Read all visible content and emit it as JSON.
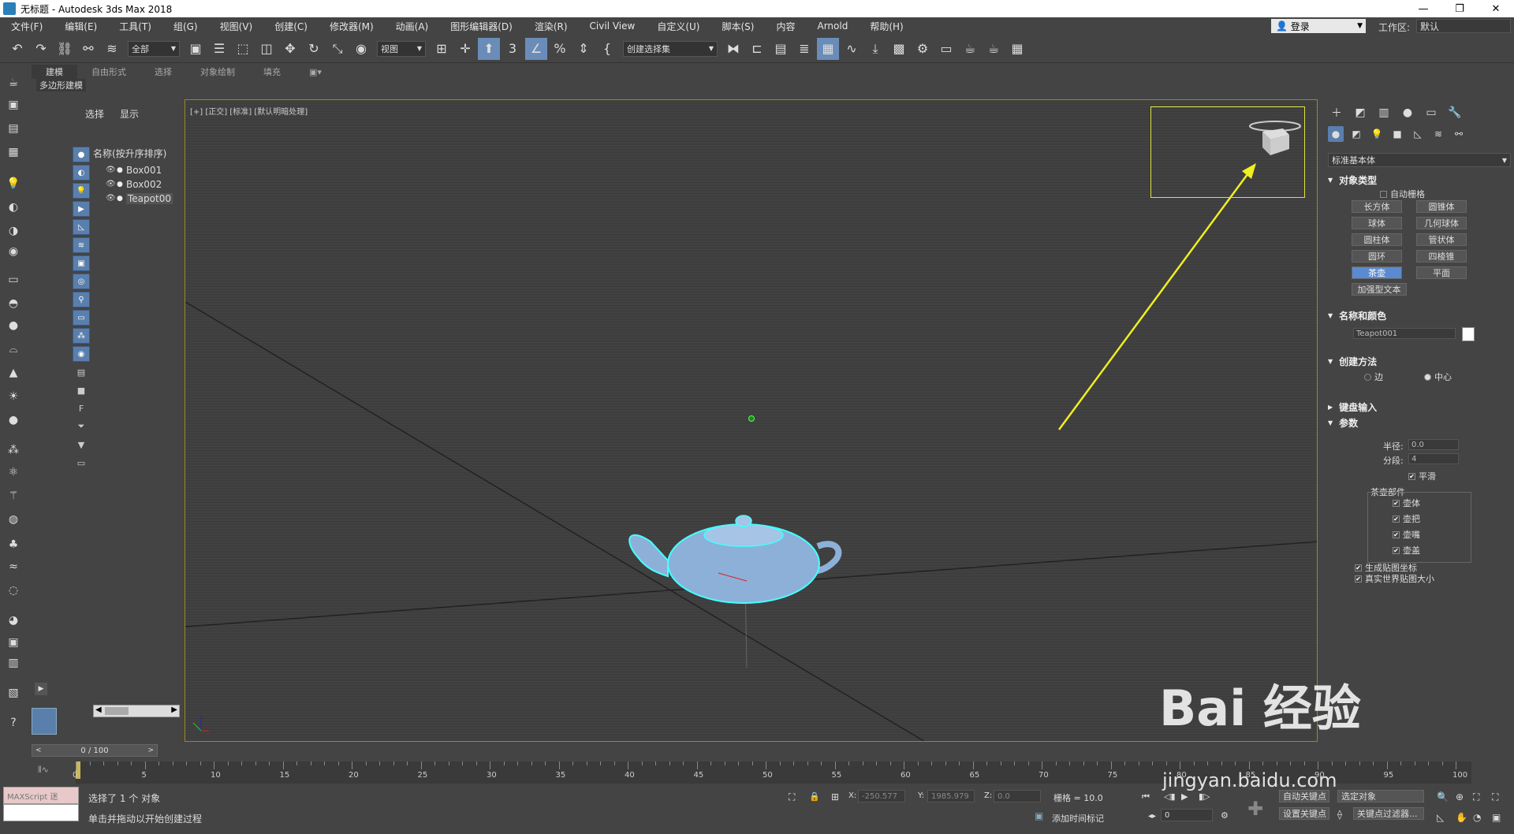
{
  "window": {
    "title": "无标题 - Autodesk 3ds Max 2018",
    "min": "—",
    "restore": "❐",
    "close": "✕"
  },
  "menu": [
    "文件(F)",
    "编辑(E)",
    "工具(T)",
    "组(G)",
    "视图(V)",
    "创建(C)",
    "修改器(M)",
    "动画(A)",
    "图形编辑器(D)",
    "渲染(R)",
    "Civil View",
    "自定义(U)",
    "脚本(S)",
    "内容",
    "Arnold",
    "帮助(H)"
  ],
  "login": {
    "label": "登录"
  },
  "workspace": {
    "label": "工作区:",
    "value": "默认"
  },
  "toolbar": {
    "filter": "全部",
    "ref_coord": "视图",
    "named_sel": "创建选择集"
  },
  "ribbon": {
    "tabs": [
      "建模",
      "自由形式",
      "选择",
      "对象绘制",
      "填充"
    ],
    "sub": "多边形建模"
  },
  "scene_explorer": {
    "tabs": [
      "选择",
      "显示"
    ],
    "header": "名称(按升序排序)",
    "items": [
      "Box001",
      "Box002",
      "Teapot00"
    ]
  },
  "viewport": {
    "label": "[+] [正交] [标准] [默认明暗处理]"
  },
  "command_panel": {
    "category": "标准基本体",
    "object_type": {
      "title": "对象类型",
      "autogrid": "自动栅格",
      "buttons": [
        "长方体",
        "圆锥体",
        "球体",
        "几何球体",
        "圆柱体",
        "管状体",
        "圆环",
        "四棱锥",
        "茶壶",
        "平面",
        "加强型文本"
      ],
      "active": "茶壶"
    },
    "name_color": {
      "title": "名称和颜色",
      "name": "Teapot001",
      "color": "#ffffff"
    },
    "creation_method": {
      "title": "创建方法",
      "edge": "边",
      "center": "中心"
    },
    "keyboard_entry": {
      "title": "键盘输入"
    },
    "params": {
      "title": "参数",
      "radius_label": "半径:",
      "radius": "0.0",
      "segments_label": "分段:",
      "segments": "4",
      "smooth": "平滑",
      "parts_title": "茶壶部件",
      "parts": [
        "壶体",
        "壶把",
        "壶嘴",
        "壶盖"
      ],
      "gen_map": "生成贴图坐标",
      "real_world": "真实世界贴图大小"
    }
  },
  "timeline": {
    "frame": "0 / 100",
    "ticks": [
      "0",
      "5",
      "10",
      "15",
      "20",
      "25",
      "30",
      "35",
      "40",
      "45",
      "50",
      "55",
      "60",
      "65",
      "70",
      "75",
      "80",
      "85",
      "90",
      "95",
      "100"
    ]
  },
  "status": {
    "maxscript": "MAXScript 迷",
    "selected": "选择了 1 个 对象",
    "prompt": "单击并拖动以开始创建过程",
    "x": "-250.577",
    "y": "1985.979",
    "z": "0.0",
    "grid": "栅格 = 10.0",
    "add_time_tag": "添加时间标记",
    "auto_key": "自动关键点",
    "set_key": "设置关键点",
    "sel_obj": "选定对象",
    "key_filter": "关键点过滤器...",
    "frame_field": "0"
  },
  "watermark": {
    "text": "Bai 经验",
    "url": "jingyan.baidu.com"
  }
}
